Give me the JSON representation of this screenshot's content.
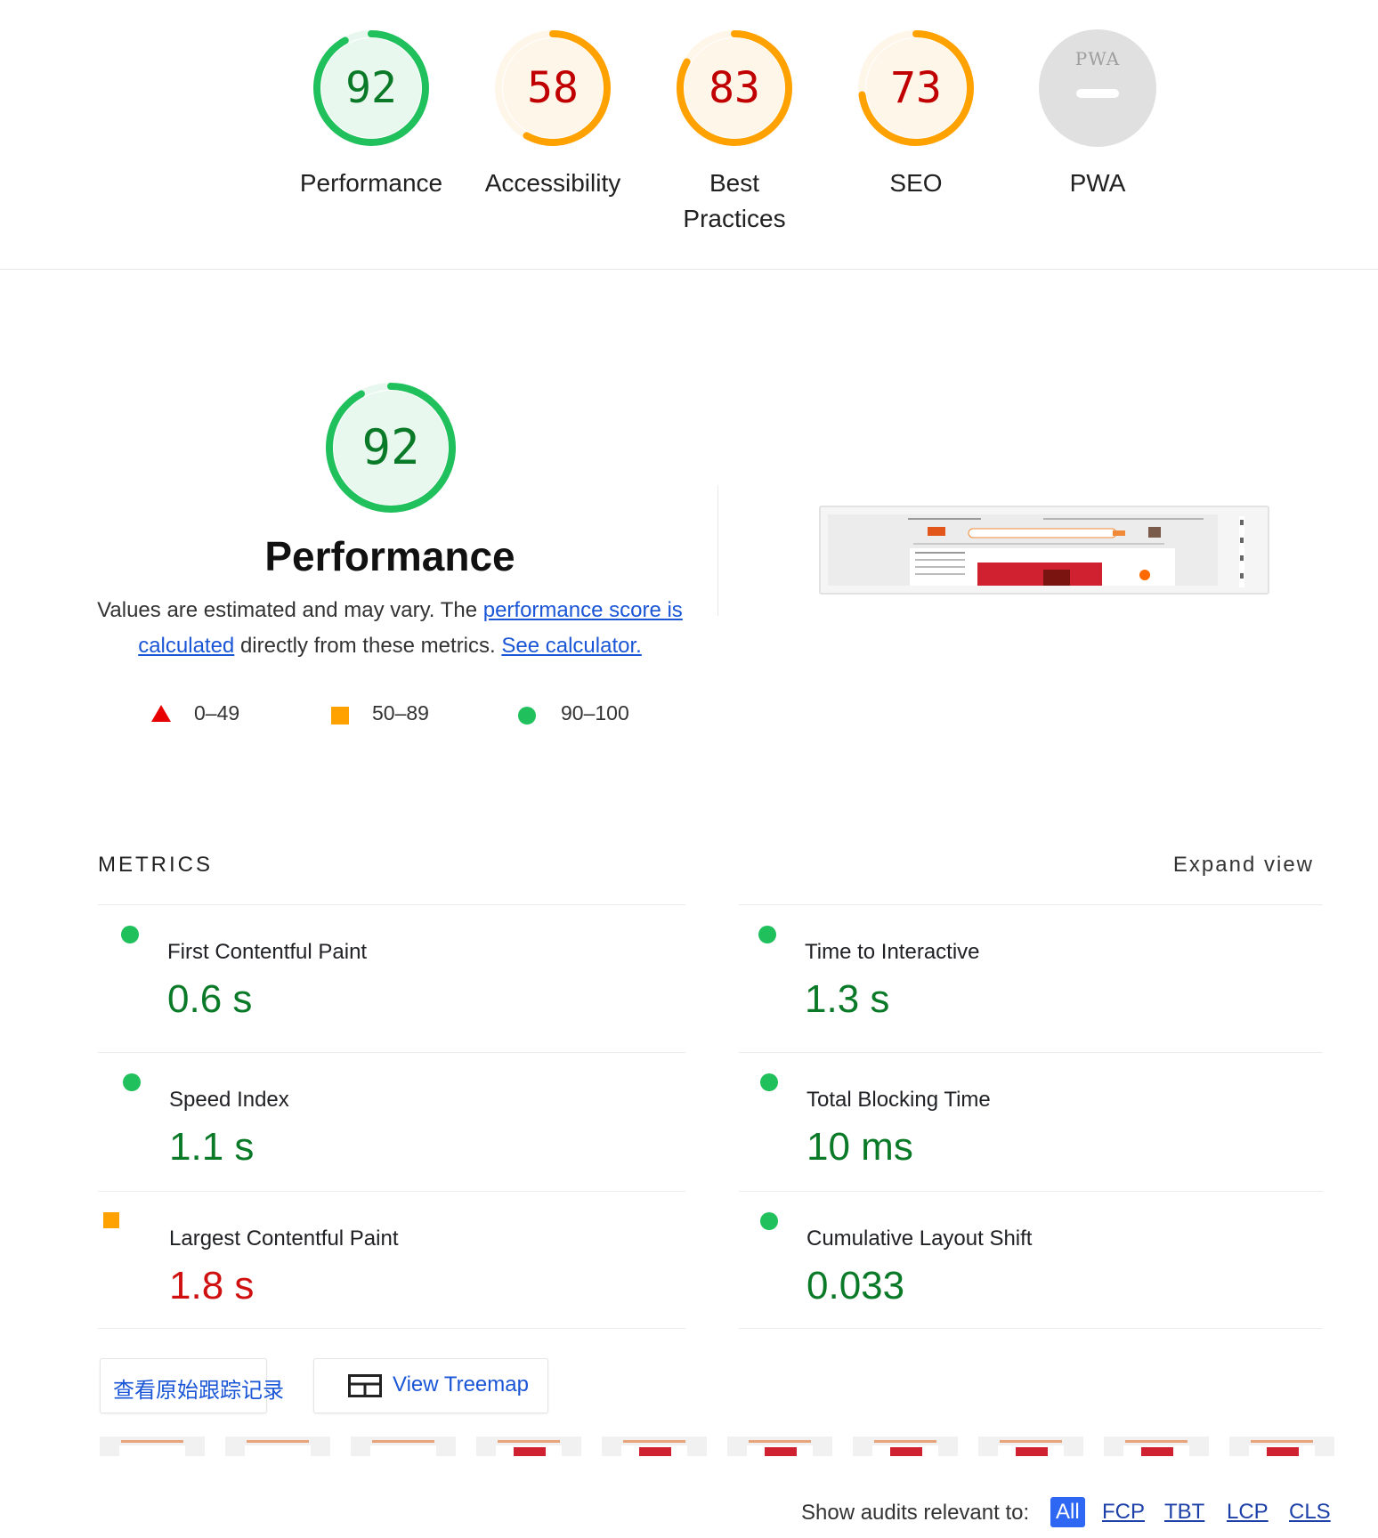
{
  "colors": {
    "pass": "#0b7a28",
    "pass_ring": "#20c05c",
    "average": "#c00000",
    "average_ring": "#ffa200",
    "fail": "#e60000",
    "pwa_gray": "#e0e0e0",
    "link": "#1a56d6"
  },
  "categories": [
    {
      "score": "92",
      "label": "Performance",
      "rating": "pass",
      "fraction": 0.92
    },
    {
      "score": "58",
      "label": "Accessibility",
      "rating": "average",
      "fraction": 0.58
    },
    {
      "score": "83",
      "label_line1": "Best",
      "label_line2": "Practices",
      "rating": "average",
      "fraction": 0.83
    },
    {
      "score": "73",
      "label": "SEO",
      "rating": "average",
      "fraction": 0.73
    },
    {
      "badge_text": "PWA",
      "label": "PWA",
      "rating": "na"
    }
  ],
  "performance": {
    "score": "92",
    "fraction": 0.92,
    "title": "Performance",
    "desc_prefix": "Values are estimated and may vary. The ",
    "desc_link1": "performance score is calculated",
    "desc_middle": " directly from these metrics. ",
    "desc_link2": "See calculator.",
    "legend": [
      {
        "icon": "triangle-icon",
        "range": "0–49"
      },
      {
        "icon": "square-icon",
        "range": "50–89"
      },
      {
        "icon": "circle-icon",
        "range": "90–100"
      }
    ]
  },
  "metrics": {
    "header": "METRICS",
    "expand_label": "Expand view",
    "items": [
      {
        "name": "First Contentful Paint",
        "value": "0.6 s",
        "rating": "pass"
      },
      {
        "name": "Time to Interactive",
        "value": "1.3 s",
        "rating": "pass"
      },
      {
        "name": "Speed Index",
        "value": "1.1 s",
        "rating": "pass"
      },
      {
        "name": "Total Blocking Time",
        "value": "10 ms",
        "rating": "pass"
      },
      {
        "name": "Largest Contentful Paint",
        "value": "1.8 s",
        "rating": "average"
      },
      {
        "name": "Cumulative Layout Shift",
        "value": "0.033",
        "rating": "pass"
      }
    ]
  },
  "buttons": {
    "trace": "查看原始跟踪记录",
    "treemap": "View Treemap"
  },
  "audit_filter": {
    "label": "Show audits relevant to:",
    "options": [
      "All",
      "FCP",
      "TBT",
      "LCP",
      "CLS"
    ],
    "active": "All"
  }
}
